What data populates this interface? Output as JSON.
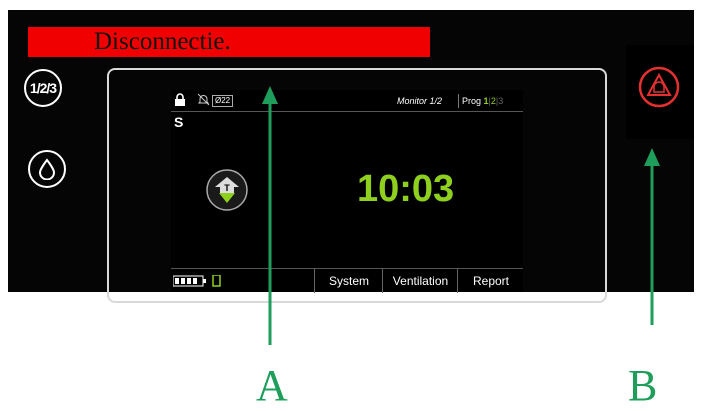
{
  "banner": {
    "text": "Disconnectie."
  },
  "buttons": {
    "program": "1/2/3",
    "program_icon": "fraction-program-icon",
    "water_icon": "water-drop-icon"
  },
  "status_bar": {
    "lock_icon": "lock-icon",
    "bell_off_icon": "bell-muted-icon",
    "code": "Ø22",
    "monitor": "Monitor 1/2",
    "prog_label": "Prog",
    "prog_1": "1",
    "prog_2": "2",
    "prog_3": "3"
  },
  "main": {
    "mode": "S",
    "vent_letter": "T",
    "time": "10:03"
  },
  "tabs": [
    "System",
    "Ventilation",
    "Report"
  ],
  "alarm": {
    "icon": "alarm-bell-icon"
  },
  "annotations": {
    "a": "A",
    "b": "B"
  },
  "colors": {
    "accent_green": "#8fd01e",
    "alarm_red": "#e53030",
    "banner_red": "#f00000",
    "arrow_green": "#1e9e5a"
  }
}
